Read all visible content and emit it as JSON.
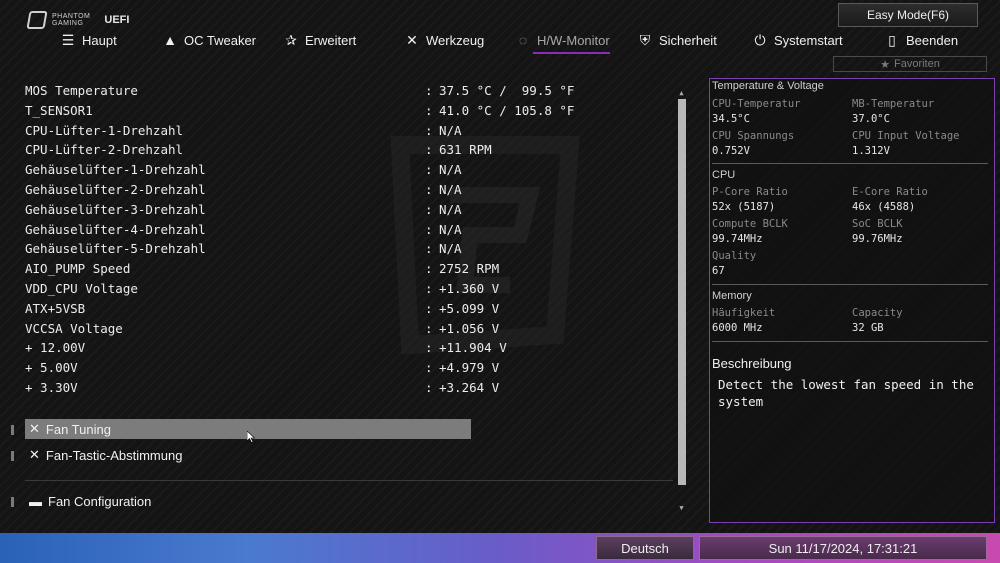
{
  "brand": {
    "logo_line1": "PHANTOM",
    "logo_line2": "GAMING",
    "uefi": "UEFI"
  },
  "easy_mode": "Easy Mode(F6)",
  "nav": [
    {
      "label": "Haupt",
      "icon": "list-icon"
    },
    {
      "label": "OC Tweaker",
      "icon": "rocket-icon"
    },
    {
      "label": "Erweitert",
      "icon": "star-icon"
    },
    {
      "label": "Werkzeug",
      "icon": "tools-icon"
    },
    {
      "label": "H/W-Monitor",
      "icon": "monitor-icon",
      "active": true
    },
    {
      "label": "Sicherheit",
      "icon": "shield-icon"
    },
    {
      "label": "Systemstart",
      "icon": "power-icon"
    },
    {
      "label": "Beenden",
      "icon": "exit-icon"
    }
  ],
  "favorites": "Favoriten",
  "sensors": [
    {
      "label": "MOS Temperature",
      "value": "37.5 °C /  99.5 °F"
    },
    {
      "label": "T_SENSOR1",
      "value": "41.0 °C / 105.8 °F"
    },
    {
      "label": "CPU-Lüfter-1-Drehzahl",
      "value": "N/A"
    },
    {
      "label": "CPU-Lüfter-2-Drehzahl",
      "value": "631 RPM"
    },
    {
      "label": "Gehäuselüfter-1-Drehzahl",
      "value": "N/A"
    },
    {
      "label": "Gehäuselüfter-2-Drehzahl",
      "value": "N/A"
    },
    {
      "label": "Gehäuselüfter-3-Drehzahl",
      "value": "N/A"
    },
    {
      "label": "Gehäuselüfter-4-Drehzahl",
      "value": "N/A"
    },
    {
      "label": "Gehäuselüfter-5-Drehzahl",
      "value": "N/A"
    },
    {
      "label": "AIO_PUMP Speed",
      "value": "2752 RPM"
    },
    {
      "label": "VDD_CPU Voltage",
      "value": "+1.360 V"
    },
    {
      "label": "ATX+5VSB",
      "value": "+5.099 V"
    },
    {
      "label": "VCCSA Voltage",
      "value": "+1.056 V"
    },
    {
      "label": "+ 12.00V",
      "value": "+11.904 V"
    },
    {
      "label": "+ 5.00V",
      "value": "+4.979 V"
    },
    {
      "label": "+ 3.30V",
      "value": "+3.264 V"
    }
  ],
  "sep": ":",
  "menu": [
    {
      "label": "Fan Tuning",
      "icon": "tools-icon",
      "selected": true
    },
    {
      "label": "Fan-Tastic-Abstimmung",
      "icon": "tools-icon"
    },
    {
      "label": "Fan Configuration",
      "icon": "folder-icon"
    }
  ],
  "panel": {
    "tv_title": "Temperature & Voltage",
    "cpu_temp_label": "CPU-Temperatur",
    "cpu_temp": "34.5°C",
    "mb_temp_label": "MB-Temperatur",
    "mb_temp": "37.0°C",
    "cpu_volt_label": "CPU Spannungs",
    "cpu_volt": "0.752V",
    "cpu_in_label": "CPU Input Voltage",
    "cpu_in": "1.312V",
    "cpu_title": "CPU",
    "pcore_label": "P-Core Ratio",
    "pcore": "52x (5187)",
    "ecore_label": "E-Core Ratio",
    "ecore": "46x (4588)",
    "cbclk_label": "Compute BCLK",
    "cbclk": "99.74MHz",
    "sbclk_label": "SoC BCLK",
    "sbclk": "99.76MHz",
    "quality_label": "Quality",
    "quality": "67",
    "mem_title": "Memory",
    "freq_label": "Häufigkeit",
    "freq": "6000 MHz",
    "cap_label": "Capacity",
    "cap": "32 GB",
    "desc_title": "Beschreibung",
    "desc_text": "Detect the lowest fan speed in the system"
  },
  "bottom": {
    "language": "Deutsch",
    "datetime": "Sun 11/17/2024, 17:31:21"
  },
  "colors": {
    "accent": "#8d2bb6",
    "panel_border": "#7a3fb0",
    "selected_bg": "#7c7c7c"
  }
}
